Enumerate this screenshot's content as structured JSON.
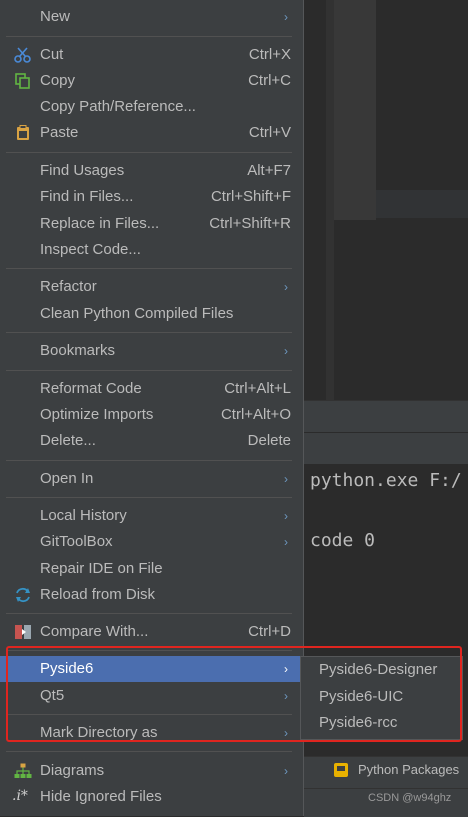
{
  "menu": {
    "new": {
      "label": "New"
    },
    "cut": {
      "label": "Cut",
      "shortcut": "Ctrl+X"
    },
    "copy": {
      "label": "Copy",
      "shortcut": "Ctrl+C"
    },
    "copy_path": {
      "label": "Copy Path/Reference..."
    },
    "paste": {
      "label": "Paste",
      "shortcut": "Ctrl+V"
    },
    "find_usages": {
      "label": "Find Usages",
      "shortcut": "Alt+F7"
    },
    "find_in_files": {
      "label": "Find in Files...",
      "shortcut": "Ctrl+Shift+F"
    },
    "replace_in_files": {
      "label": "Replace in Files...",
      "shortcut": "Ctrl+Shift+R"
    },
    "inspect_code": {
      "label": "Inspect Code..."
    },
    "refactor": {
      "label": "Refactor"
    },
    "clean_python": {
      "label": "Clean Python Compiled Files"
    },
    "bookmarks": {
      "label": "Bookmarks"
    },
    "reformat_code": {
      "label": "Reformat Code",
      "shortcut": "Ctrl+Alt+L"
    },
    "optimize_imports": {
      "label": "Optimize Imports",
      "shortcut": "Ctrl+Alt+O"
    },
    "delete": {
      "label": "Delete...",
      "shortcut": "Delete"
    },
    "open_in": {
      "label": "Open In"
    },
    "local_history": {
      "label": "Local History"
    },
    "gittoolbox": {
      "label": "GitToolBox"
    },
    "repair_ide": {
      "label": "Repair IDE on File"
    },
    "reload_disk": {
      "label": "Reload from Disk"
    },
    "compare_with": {
      "label": "Compare With...",
      "shortcut": "Ctrl+D"
    },
    "pyside6": {
      "label": "Pyside6"
    },
    "qt5": {
      "label": "Qt5"
    },
    "mark_directory": {
      "label": "Mark Directory as"
    },
    "diagrams": {
      "label": "Diagrams"
    },
    "hide_ignored": {
      "label": "Hide Ignored Files"
    }
  },
  "submenu": {
    "items": [
      "Pyside6-Designer",
      "Pyside6-UIC",
      "Pyside6-rcc"
    ]
  },
  "console": {
    "line1": "python.exe F:/",
    "line2": "code 0"
  },
  "bottom_bar": {
    "python_packages": "Python Packages"
  },
  "watermark": "CSDN @w94ghz",
  "colors": {
    "highlight_border": "#e0251f",
    "selection": "#4b6eaf"
  }
}
